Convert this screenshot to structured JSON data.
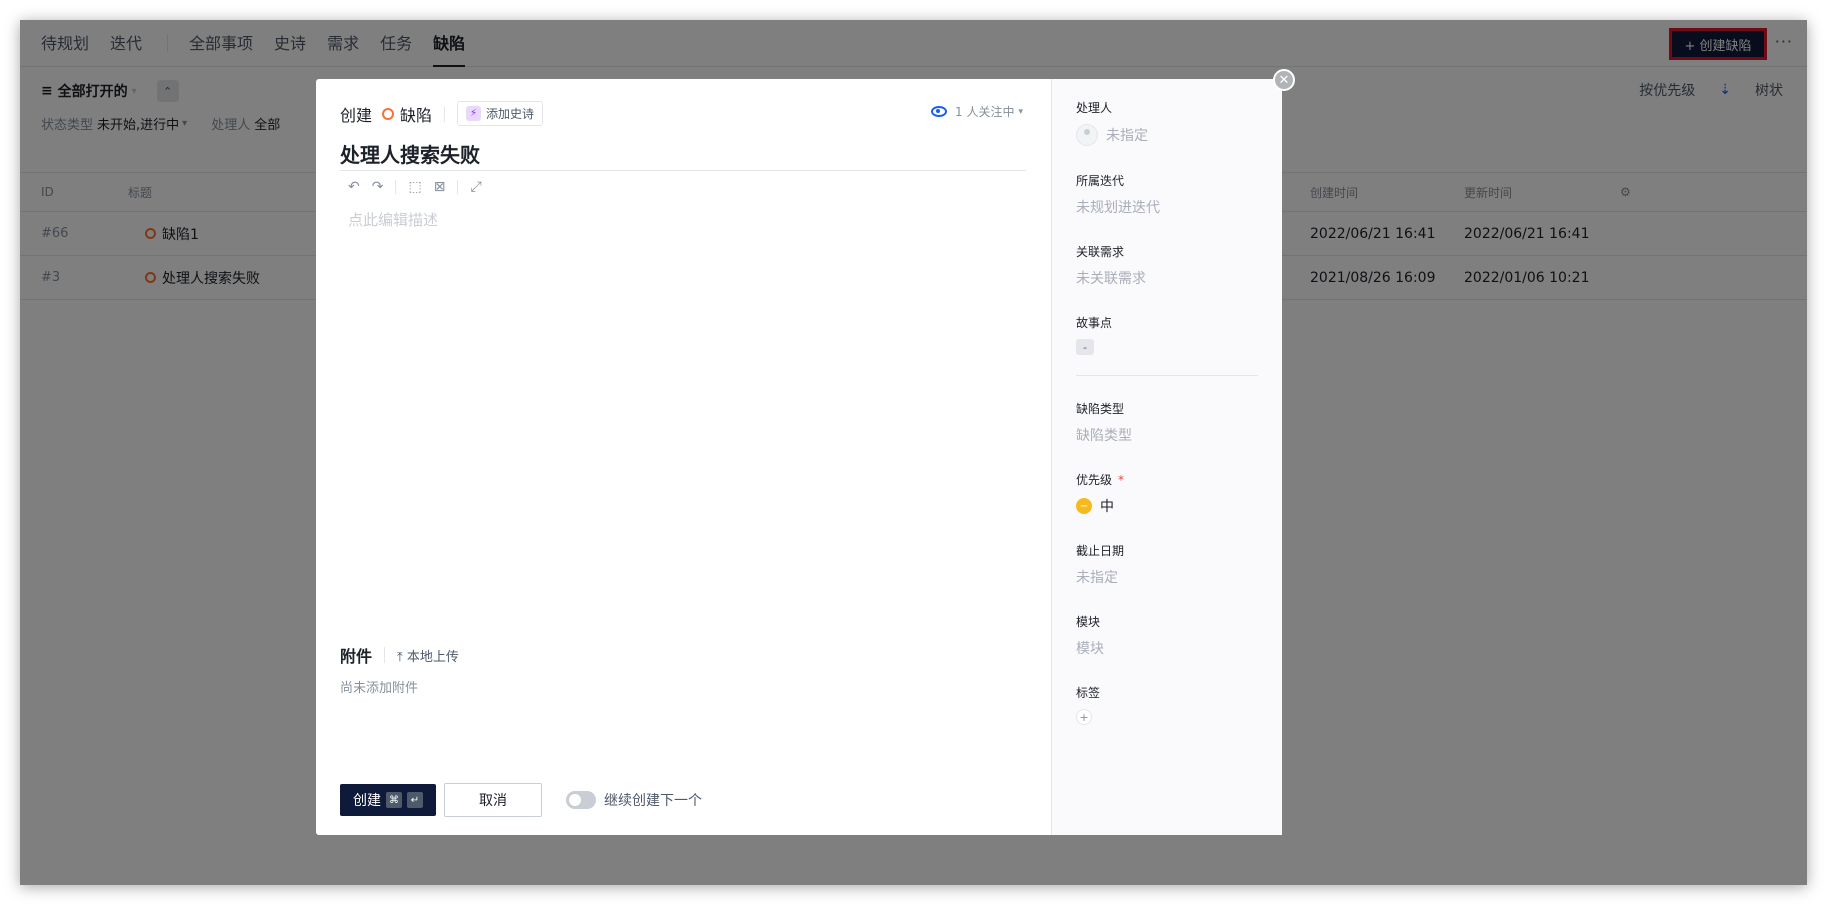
{
  "nav": {
    "tabs": [
      "待规划",
      "迭代",
      "全部事项",
      "史诗",
      "需求",
      "任务",
      "缺陷"
    ],
    "create_label": "+ 创建缺陷",
    "more": "···"
  },
  "filters": {
    "view": "全部打开的",
    "collapse_icon": "chevrons-up-icon",
    "status_label": "状态类型",
    "status_value": "未开始,进行中",
    "assignee_label": "处理人",
    "assignee_value": "全部",
    "sort": "按优先级",
    "tree": "树状"
  },
  "table": {
    "headers": [
      "ID",
      "标题",
      "创建时间",
      "更新时间"
    ],
    "rows": [
      {
        "id": "#66",
        "title": "缺陷1",
        "created": "2022/06/21 16:41",
        "updated": "2022/06/21 16:41"
      },
      {
        "id": "#3",
        "title": "处理人搜索失败",
        "created": "2021/08/26 16:09",
        "updated": "2022/01/06 10:21"
      }
    ]
  },
  "modal": {
    "create_label": "创建",
    "type_label": "缺陷",
    "add_epic": "添加史诗",
    "watchers": "1 人关注中",
    "title": "处理人搜索失败",
    "desc_placeholder": "点此编辑描述",
    "attach_title": "附件",
    "upload_label": "本地上传",
    "attach_empty": "尚未添加附件",
    "btn_create": "创建",
    "kbd1": "⌘",
    "kbd2": "↵",
    "btn_cancel": "取消",
    "continue_label": "继续创建下一个"
  },
  "side": {
    "assignee_label": "处理人",
    "assignee_value": "未指定",
    "iteration_label": "所属迭代",
    "iteration_value": "未规划进迭代",
    "req_label": "关联需求",
    "req_value": "未关联需求",
    "points_label": "故事点",
    "points_value": "-",
    "bugtype_label": "缺陷类型",
    "bugtype_value": "缺陷类型",
    "priority_label": "优先级",
    "priority_required": "*",
    "priority_value": "中",
    "due_label": "截止日期",
    "due_value": "未指定",
    "module_label": "模块",
    "module_value": "模块",
    "tags_label": "标签",
    "tags_add": "+"
  }
}
